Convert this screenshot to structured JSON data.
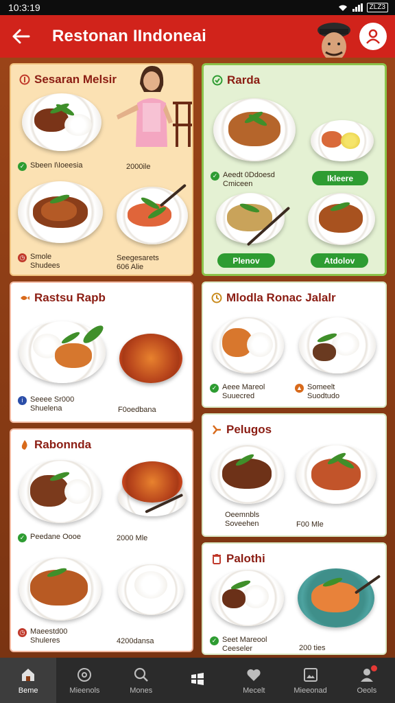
{
  "status_bar": {
    "time": "10:3:19",
    "battery": "ZLZ3"
  },
  "app_bar": {
    "title": "Restonan IIndoneai"
  },
  "cards": {
    "card1": {
      "title": "Sesaran Melsir",
      "item1_name": "Sbeen I\\Ioeesia",
      "item1_price": "2000ile",
      "item2_line1": "Smole",
      "item2_line2": "Shudees",
      "item3_line1": "Seegesarets",
      "item3_line2": "606 Alie"
    },
    "card2": {
      "title": "Rarda",
      "item1_line1": "Aeedt 0Ddoesd",
      "item1_line2": "Cmiceen",
      "button1": "Ikleere",
      "button2": "Plenov",
      "button3": "Atdolov"
    },
    "card3": {
      "title": "Rastsu Rapb",
      "item1_line1": "Seeee Sr000",
      "item1_line2": "Shuelena",
      "item2_line1": "F0oedbana"
    },
    "card4": {
      "title": "Mlodla Ronac Jalalr",
      "item1_line1": "Aeee Mareol",
      "item1_line2": "Suuecred",
      "item2_line1": "Someelt",
      "item2_line2": "Suodtudo"
    },
    "card5": {
      "title": "Rabonnda",
      "item1_name": "Peedane Oooe",
      "item1_price": "2000 Mle",
      "item2_line1": "Maeestd00",
      "item2_line2": "Shuleres",
      "item3_line1": "4200dansa"
    },
    "card6": {
      "title": "Pelugos",
      "item1_line1": "Oeemnbls",
      "item1_line2": "Soveehen",
      "item2_line1": "F00 Mle"
    },
    "card7": {
      "title": "Palothi",
      "item1_line1": "Seet Mareool",
      "item1_line2": "Ceeseler",
      "item2_line1": "200 ties"
    }
  },
  "bottom_nav": [
    {
      "label": "Beme",
      "icon": "home-icon",
      "active": true
    },
    {
      "label": "Mieenols",
      "icon": "compass-icon",
      "active": false
    },
    {
      "label": "Mones",
      "icon": "search-icon",
      "active": false
    },
    {
      "label": "",
      "icon": "windows-icon",
      "active": false
    },
    {
      "label": "Mecelt",
      "icon": "heart-icon",
      "active": false
    },
    {
      "label": "Mieeonad",
      "icon": "image-icon",
      "active": false
    },
    {
      "label": "Oeols",
      "icon": "person-icon",
      "active": false
    }
  ],
  "colors": {
    "app_bar": "#d1231b",
    "title_text": "#8b1d13",
    "green_button": "#2e9c32",
    "nav_bg": "#2b2b2b"
  }
}
